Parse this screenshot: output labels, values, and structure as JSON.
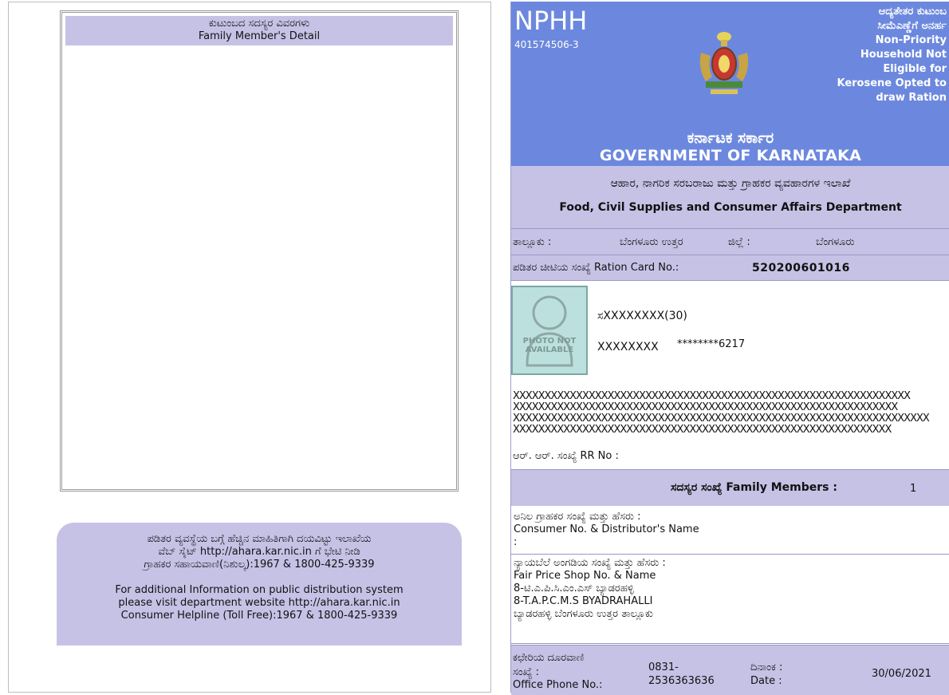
{
  "left": {
    "family_title_kn": "ಕುಟುಂಬದ ಸದಸ್ಯರ ವಿವರಗಳು",
    "family_title_en": "Family Member's Detail",
    "info_kn_1": "ಪಡಿತರ ವ್ಯವಸ್ಥೆಯ ಬಗ್ಗೆ ಹೆಚ್ಚಿನ ಮಾಹಿತಿಗಾಗಿ ದಯವಿಟ್ಟು ಇಲಾಖೆಯ",
    "info_kn_2": "ವೆಬ್ ಸೈಟ್ http://ahara.kar.nic.in ಗೆ ಭೇಟಿ ನೀಡಿ",
    "info_kn_3": "ಗ್ರಾಹಕರ ಸಹಾಯವಾಣಿ(ನಿಶುಲ್ಕ):1967 & 1800-425-9339",
    "info_en_1": "For additional Information on public distribution system",
    "info_en_2": "please visit department website http://ahara.kar.nic.in",
    "info_en_3": "Consumer Helpline (Toll Free):1967 & 1800-425-9339"
  },
  "card": {
    "category": "NPHH",
    "card_code": "401574506-3",
    "status_kn_1": "ಆದ್ಯತೇತರ ಕುಟುಂಬ",
    "status_kn_2": "ಸೀಮೆಎಣ್ಣೆಗೆ ಅನರ್ಹ",
    "status_en": "Non-Priority Household Not Eligible for Kerosene Opted to draw Ration",
    "govt_kn": "ಕರ್ನಾಟಕ ಸರ್ಕಾರ",
    "govt_en": "GOVERNMENT OF KARNATAKA",
    "dept_kn": "ಆಹಾರ, ನಾಗರಿಕ ಸರಬರಾಜು ಮತ್ತು ಗ್ರಾಹಕರ ವ್ಯವಹಾರಗಳ ಇಲಾಖೆ",
    "dept_en": "Food, Civil Supplies and Consumer Affairs Department",
    "taluk_label": "ತಾಲ್ಲೂಕು :",
    "taluk_value": "ಬೆಂಗಳೂರು ಉತ್ತರ",
    "district_label": "ಜಿಲ್ಲೆ :",
    "district_value": "ಬೆಂಗಳೂರು",
    "rc_label": "ಪಡಿತರ ಚೀಟಿಯ ಸಂಖ್ಯೆ Ration Card No.:",
    "rc_value": "520200601016",
    "photo_text": "PHOTO NOT AVAILABLE",
    "holder_name": "ಸXXXXXXXX(30)",
    "holder_id": "XXXXXXXX",
    "aadhaar_masked": "********6217",
    "address_lines": [
      "XXXXXXXXXXXXXXXXXXXXXXXXXXXXXXXXXXXXXXXXXXXXXXXXXXXXXXXXXXXXXXX",
      "XXXXXXXXXXXXXXXXXXXXXXXXXXXXXXXXXXXXXXXXXXXXXXXXXXXXXXXXXXXXX",
      "XXXXXXXXXXXXXXXXXXXXXXXXXXXXXXXXXXXXXXXXXXXXXXXXXXXXXXXXXXXXXXXXXX",
      "XXXXXXXXXXXXXXXXXXXXXXXXXXXXXXXXXXXXXXXXXXXXXXXXXXXXXXXXXXXX"
    ],
    "rr_label": "ಆರ್. ಆರ್. ಸಂಖ್ಯೆ RR No :",
    "members_label": "ಸದಸ್ಯರ ಸಂಖ್ಯೆ Family Members :",
    "members_count": "1",
    "consumer_kn": "ಅನಿಲ ಗ್ರಾಹಕರ ಸಂಖ್ಯೆ ಮತ್ತು ಹೆಸರು :",
    "consumer_en": "Consumer No. & Distributor's Name",
    "consumer_value": ":",
    "fps_kn": "ನ್ಯಾಯಬೆಲೆ ಅಂಗಡಿಯ ಸಂಖ್ಯೆ ಮತ್ತು ಹೆಸರು :",
    "fps_en": "Fair Price Shop No. & Name",
    "fps_line1": "8-ಟಿ.ಎ.ಪಿ.ಸಿ.ಎಂ.ಎಸ್ ಬ್ಯಾಡರಹಳ್ಳಿ",
    "fps_line2": "8-T.A.P.C.M.S BYADRAHALLI",
    "fps_line3": "ಬ್ಯಾಡರಹಳ್ಳಿ ಬೆಂಗಳೂರು ಉತ್ತರ ತಾಲ್ಲೂಕು",
    "office_phone_kn_1": "ಕಛೇರಿಯ ದೂರವಾಣಿ",
    "office_phone_kn_2": "ಸಂಖ್ಯೆ :",
    "office_phone_en": "Office Phone No.:",
    "phone_1": "0831-",
    "phone_2": "2536363636",
    "date_kn": "ದಿನಾಂಕ :",
    "date_en": "Date :",
    "date_value": "30/06/2021",
    "colors": {
      "header_blue": "#6c88de",
      "lavender": "#c6c2e6"
    }
  }
}
